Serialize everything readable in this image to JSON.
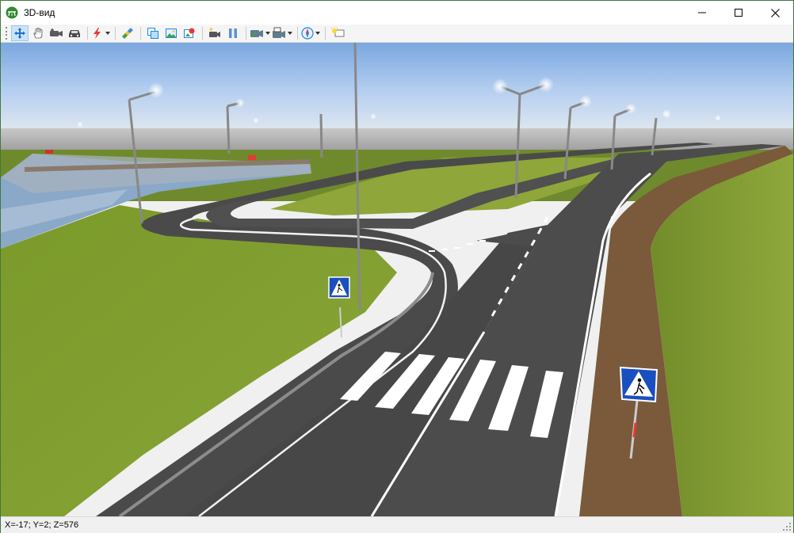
{
  "window": {
    "title": "3D-вид",
    "icon": "road-app-icon",
    "controls": [
      "minimize-icon",
      "maximize-icon",
      "close-icon"
    ]
  },
  "toolbar": {
    "buttons": [
      {
        "icon": "move-arrows-icon",
        "active": true
      },
      {
        "icon": "hand-pan-icon",
        "active": false
      },
      {
        "icon": "camera-icon",
        "active": false
      },
      {
        "icon": "car-icon",
        "active": false
      },
      {
        "icon": "lightning-icon",
        "dropdown": true
      },
      {
        "icon": "layers-icon"
      },
      {
        "icon": "copy-view-icon"
      },
      {
        "icon": "picture-icon"
      },
      {
        "icon": "render-icon"
      },
      {
        "icon": "video-camera-icon"
      },
      {
        "icon": "pause-icon"
      },
      {
        "icon": "record-video-icon",
        "dropdown": true
      },
      {
        "icon": "export-video-icon",
        "dropdown": true
      },
      {
        "icon": "compass-icon",
        "dropdown": true
      },
      {
        "icon": "light-bulb-icon"
      }
    ]
  },
  "scene": {
    "sign_left": "pedestrian-crossing-sign",
    "sign_right": "pedestrian-crossing-sign"
  },
  "status": {
    "coordinates": "X=-17; Y=2; Z=576"
  }
}
